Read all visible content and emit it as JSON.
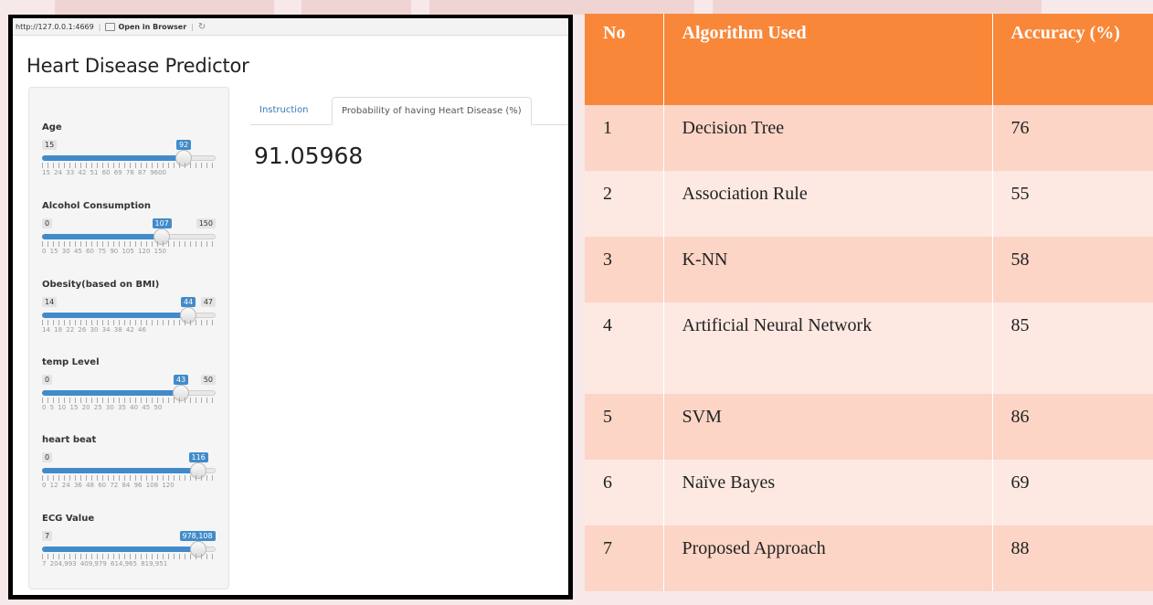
{
  "browser": {
    "url": "http://127.0.0.1:4669",
    "open_in_browser": "Open in Browser"
  },
  "app": {
    "title": "Heart Disease Predictor",
    "sliders": [
      {
        "label": "Age",
        "min": "15",
        "max": "",
        "value": "92",
        "fraction": 0.85,
        "ticks": "15  24  33  42  51  60  69  78  87  9600"
      },
      {
        "label": "Alcohol Consumption",
        "min": "0",
        "max": "150",
        "value": "107",
        "fraction": 0.71,
        "ticks": "0  15  30  45  60  75  90  105 120     150"
      },
      {
        "label": "Obesity(based on BMI)",
        "min": "14",
        "max": "47",
        "value": "44",
        "fraction": 0.88,
        "ticks": "14  18  22  26  30  34  38  42  46"
      },
      {
        "label": "temp Level",
        "min": "0",
        "max": "50",
        "value": "43",
        "fraction": 0.83,
        "ticks": "0  5  10  15  20  25  30  35  40  45  50"
      },
      {
        "label": "heart beat",
        "min": "0",
        "max": "",
        "value": "116",
        "fraction": 0.94,
        "ticks": "0  12  24  36  48  60  72  84  96  108 120"
      },
      {
        "label": "ECG Value",
        "min": "7",
        "max": "",
        "value": "978,108",
        "fraction": 0.94,
        "ticks": "7    204,993 409,979 614,965 819,951"
      }
    ],
    "tabs": [
      "Instruction",
      "Probability of having Heart Disease (%)"
    ],
    "active_tab": 1,
    "output": "91.05968"
  },
  "table": {
    "headers": [
      "No",
      "Algorithm Used",
      "Accuracy (%)"
    ],
    "rows": [
      [
        "1",
        "Decision Tree",
        "76"
      ],
      [
        "2",
        "Association Rule",
        "55"
      ],
      [
        "3",
        "K-NN",
        "58"
      ],
      [
        "4",
        "Artificial Neural Network",
        "85"
      ],
      [
        "5",
        "SVM",
        "86"
      ],
      [
        "6",
        "Naïve Bayes",
        "69"
      ],
      [
        "7",
        "Proposed Approach",
        "88"
      ]
    ]
  },
  "colors": {
    "header_bg": "#f9873a",
    "row_dark": "#fcd5c6",
    "row_light": "#fde9e2",
    "slider_fill": "#428bca"
  }
}
